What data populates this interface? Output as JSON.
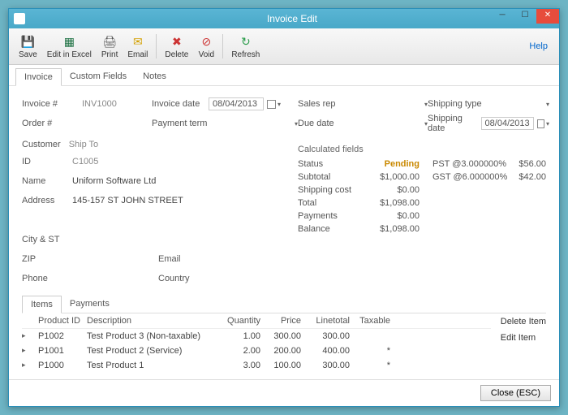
{
  "window": {
    "title": "Invoice Edit"
  },
  "toolbar": {
    "save": "Save",
    "excel": "Edit in Excel",
    "print": "Print",
    "email": "Email",
    "delete": "Delete",
    "void": "Void",
    "refresh": "Refresh",
    "help": "Help"
  },
  "tabs": {
    "invoice": "Invoice",
    "custom": "Custom Fields",
    "notes": "Notes"
  },
  "header": {
    "invoice_no_lbl": "Invoice #",
    "invoice_no": "INV1000",
    "invoice_date_lbl": "Invoice date",
    "invoice_date": "08/04/2013",
    "sales_rep_lbl": "Sales rep",
    "shipping_type_lbl": "Shipping type",
    "order_no_lbl": "Order #",
    "payment_term_lbl": "Payment term",
    "due_date_lbl": "Due date",
    "shipping_date_lbl": "Shipping date",
    "shipping_date": "08/04/2013"
  },
  "customer": {
    "section": "Customer",
    "tab_shipto": "Ship To",
    "id_lbl": "ID",
    "id": "C1005",
    "name_lbl": "Name",
    "name": "Uniform Software Ltd",
    "address_lbl": "Address",
    "address": "145-157 ST JOHN STREET",
    "cityst_lbl": "City & ST",
    "zip_lbl": "ZIP",
    "email_lbl": "Email",
    "phone_lbl": "Phone",
    "country_lbl": "Country"
  },
  "calc": {
    "section": "Calculated fields",
    "status_lbl": "Status",
    "status": "Pending",
    "subtotal_lbl": "Subtotal",
    "subtotal": "$1,000.00",
    "shipcost_lbl": "Shipping cost",
    "shipcost": "$0.00",
    "total_lbl": "Total",
    "total": "$1,098.00",
    "payments_lbl": "Payments",
    "payments": "$0.00",
    "balance_lbl": "Balance",
    "balance": "$1,098.00"
  },
  "tax": {
    "pst_lbl": "PST @3.000000%",
    "pst": "$56.00",
    "gst_lbl": "GST @6.000000%",
    "gst": "$42.00"
  },
  "subtabs": {
    "items": "Items",
    "payments": "Payments"
  },
  "items": {
    "headers": {
      "pid": "Product ID",
      "desc": "Description",
      "qty": "Quantity",
      "price": "Price",
      "linetotal": "Linetotal",
      "taxable": "Taxable"
    },
    "rows": [
      {
        "pid": "P1002",
        "desc": "Test Product 3 (Non-taxable)",
        "qty": "1.00",
        "price": "300.00",
        "linetotal": "300.00",
        "taxable": ""
      },
      {
        "pid": "P1001",
        "desc": "Test Product 2 (Service)",
        "qty": "2.00",
        "price": "200.00",
        "linetotal": "400.00",
        "taxable": "*"
      },
      {
        "pid": "P1000",
        "desc": "Test Product 1",
        "qty": "3.00",
        "price": "100.00",
        "linetotal": "300.00",
        "taxable": "*"
      }
    ]
  },
  "actions": {
    "delete_item": "Delete Item",
    "edit_item": "Edit Item"
  },
  "footer": {
    "close": "Close (ESC)"
  }
}
